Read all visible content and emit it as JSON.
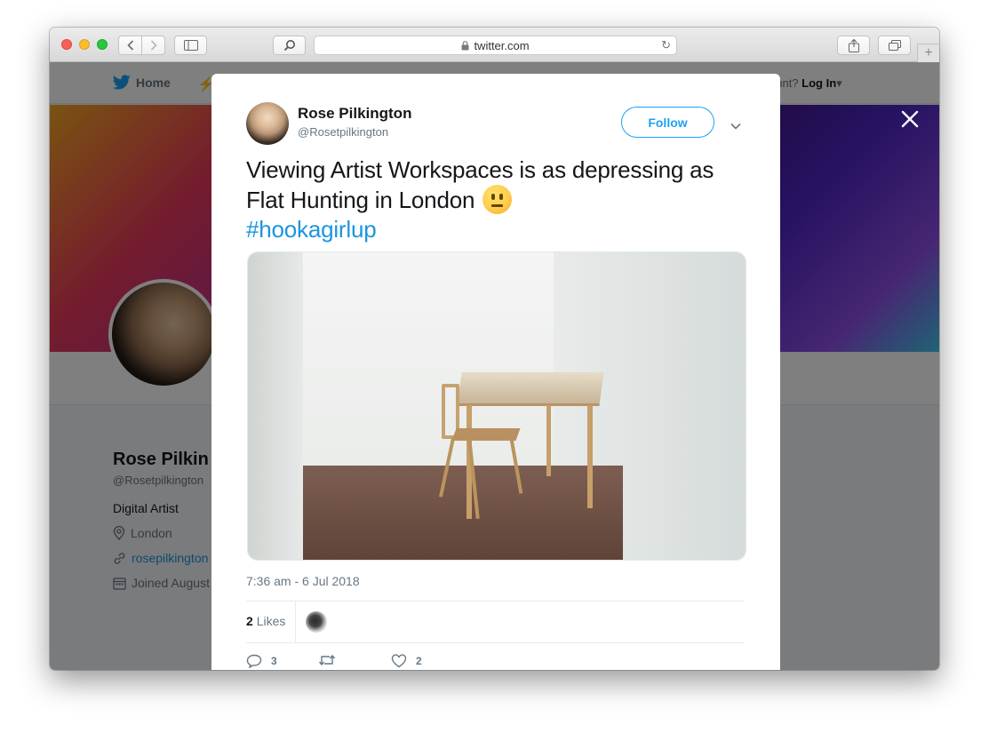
{
  "browser": {
    "url": "twitter.com"
  },
  "twitter_nav": {
    "home_label": "Home",
    "account_prompt": "ccount?",
    "login_label": "Log In"
  },
  "profile": {
    "name": "Rose Pilkin",
    "handle": "@Rosetpilkington",
    "bio": "Digital Artist",
    "location": "London",
    "website": "rosepilkington",
    "joined": "Joined August"
  },
  "tweet": {
    "author_name": "Rose Pilkington",
    "author_handle": "@Rosetpilkington",
    "follow_label": "Follow",
    "text": "Viewing Artist Workspaces is as depressing as Flat Hunting in London",
    "hashtag": "#hookagirlup",
    "timestamp": "7:36 am - 6 Jul 2018",
    "likes_count": "2",
    "likes_label": "Likes",
    "replies_count": "3",
    "hearts_count": "2"
  },
  "colors": {
    "twitter_blue": "#1da1f2",
    "link_blue": "#1b95e0",
    "text_dark": "#14171a",
    "text_gray": "#657786"
  }
}
